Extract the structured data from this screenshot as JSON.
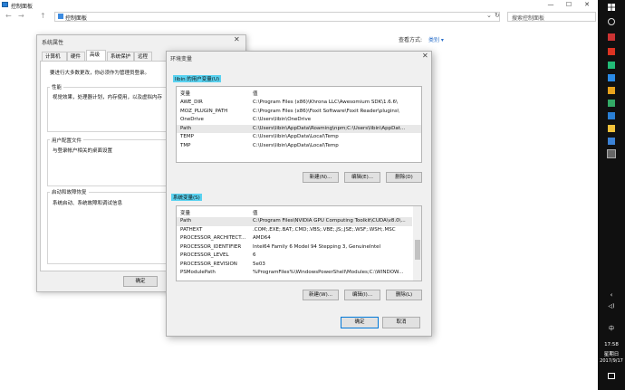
{
  "controlpanel": {
    "window_title": "控制面板",
    "address": "控制面板",
    "search_placeholder": "搜索控制面板",
    "viewby_label": "查看方式:",
    "viewby_value": "类别 ▾",
    "min": "—",
    "max": "☐",
    "close": "✕",
    "back": "←",
    "forward": "→",
    "up": "↑",
    "dropdown": "⌄",
    "refresh": "↻"
  },
  "sysprop": {
    "title": "系统属性",
    "close": "✕",
    "tabs": [
      "计算机名",
      "硬件",
      "高级",
      "系统保护",
      "远程"
    ],
    "notice": "要进行大多数更改，你必须作为管理员登录。",
    "perf_title": "性能",
    "perf_text": "视觉效果，处理器计划，内存使用，以及虚拟内存",
    "profile_title": "用户配置文件",
    "profile_text": "与登录帐户相关的桌面设置",
    "startup_title": "启动和故障恢复",
    "startup_text": "系统启动、系统故障和调试信息",
    "ok": "确定"
  },
  "envvar": {
    "title": "环境变量",
    "close": "✕",
    "user_section": "libin 的用户变量(U)",
    "sys_section": "系统变量(S)",
    "col_var": "变量",
    "col_val": "值",
    "user_vars": [
      {
        "name": "AWE_DIR",
        "value": "C:\\Program Files (x86)\\Khrona LLC\\Awesomium SDK\\1.6.6\\"
      },
      {
        "name": "MOZ_PLUGIN_PATH",
        "value": "C:\\Program Files (x86)\\Foxit Software\\Foxit Reader\\plugins\\"
      },
      {
        "name": "OneDrive",
        "value": "C:\\Users\\libin\\OneDrive"
      },
      {
        "name": "Path",
        "value": "C:\\Users\\libin\\AppData\\Roaming\\npm;C:\\Users\\libin\\AppDat..."
      },
      {
        "name": "TEMP",
        "value": "C:\\Users\\libin\\AppData\\Local\\Temp"
      },
      {
        "name": "TMP",
        "value": "C:\\Users\\libin\\AppData\\Local\\Temp"
      }
    ],
    "sys_vars": [
      {
        "name": "Path",
        "value": "C:\\Program Files\\NVIDIA GPU Computing Toolkit\\CUDA\\v8.0\\..."
      },
      {
        "name": "PATHEXT",
        "value": ".COM;.EXE;.BAT;.CMD;.VBS;.VBE;.JS;.JSE;.WSF;.WSH;.MSC"
      },
      {
        "name": "PROCESSOR_ARCHITECT...",
        "value": "AMD64"
      },
      {
        "name": "PROCESSOR_IDENTIFIER",
        "value": "Intel64 Family 6 Model 94 Stepping 3, GenuineIntel"
      },
      {
        "name": "PROCESSOR_LEVEL",
        "value": "6"
      },
      {
        "name": "PROCESSOR_REVISION",
        "value": "5e03"
      },
      {
        "name": "PSModulePath",
        "value": "%ProgramFiles%\\WindowsPowerShell\\Modules;C:\\WINDOW..."
      }
    ],
    "user_buttons": [
      "新建(N)...",
      "编辑(E)...",
      "删除(D)"
    ],
    "sys_buttons": [
      "新建(W)...",
      "编辑(I)...",
      "删除(L)"
    ],
    "ok": "确定",
    "cancel": "取消"
  },
  "taskbar": {
    "ime": "中",
    "time": "17:58",
    "weekday": "星期日",
    "date": "2017/9/17"
  }
}
